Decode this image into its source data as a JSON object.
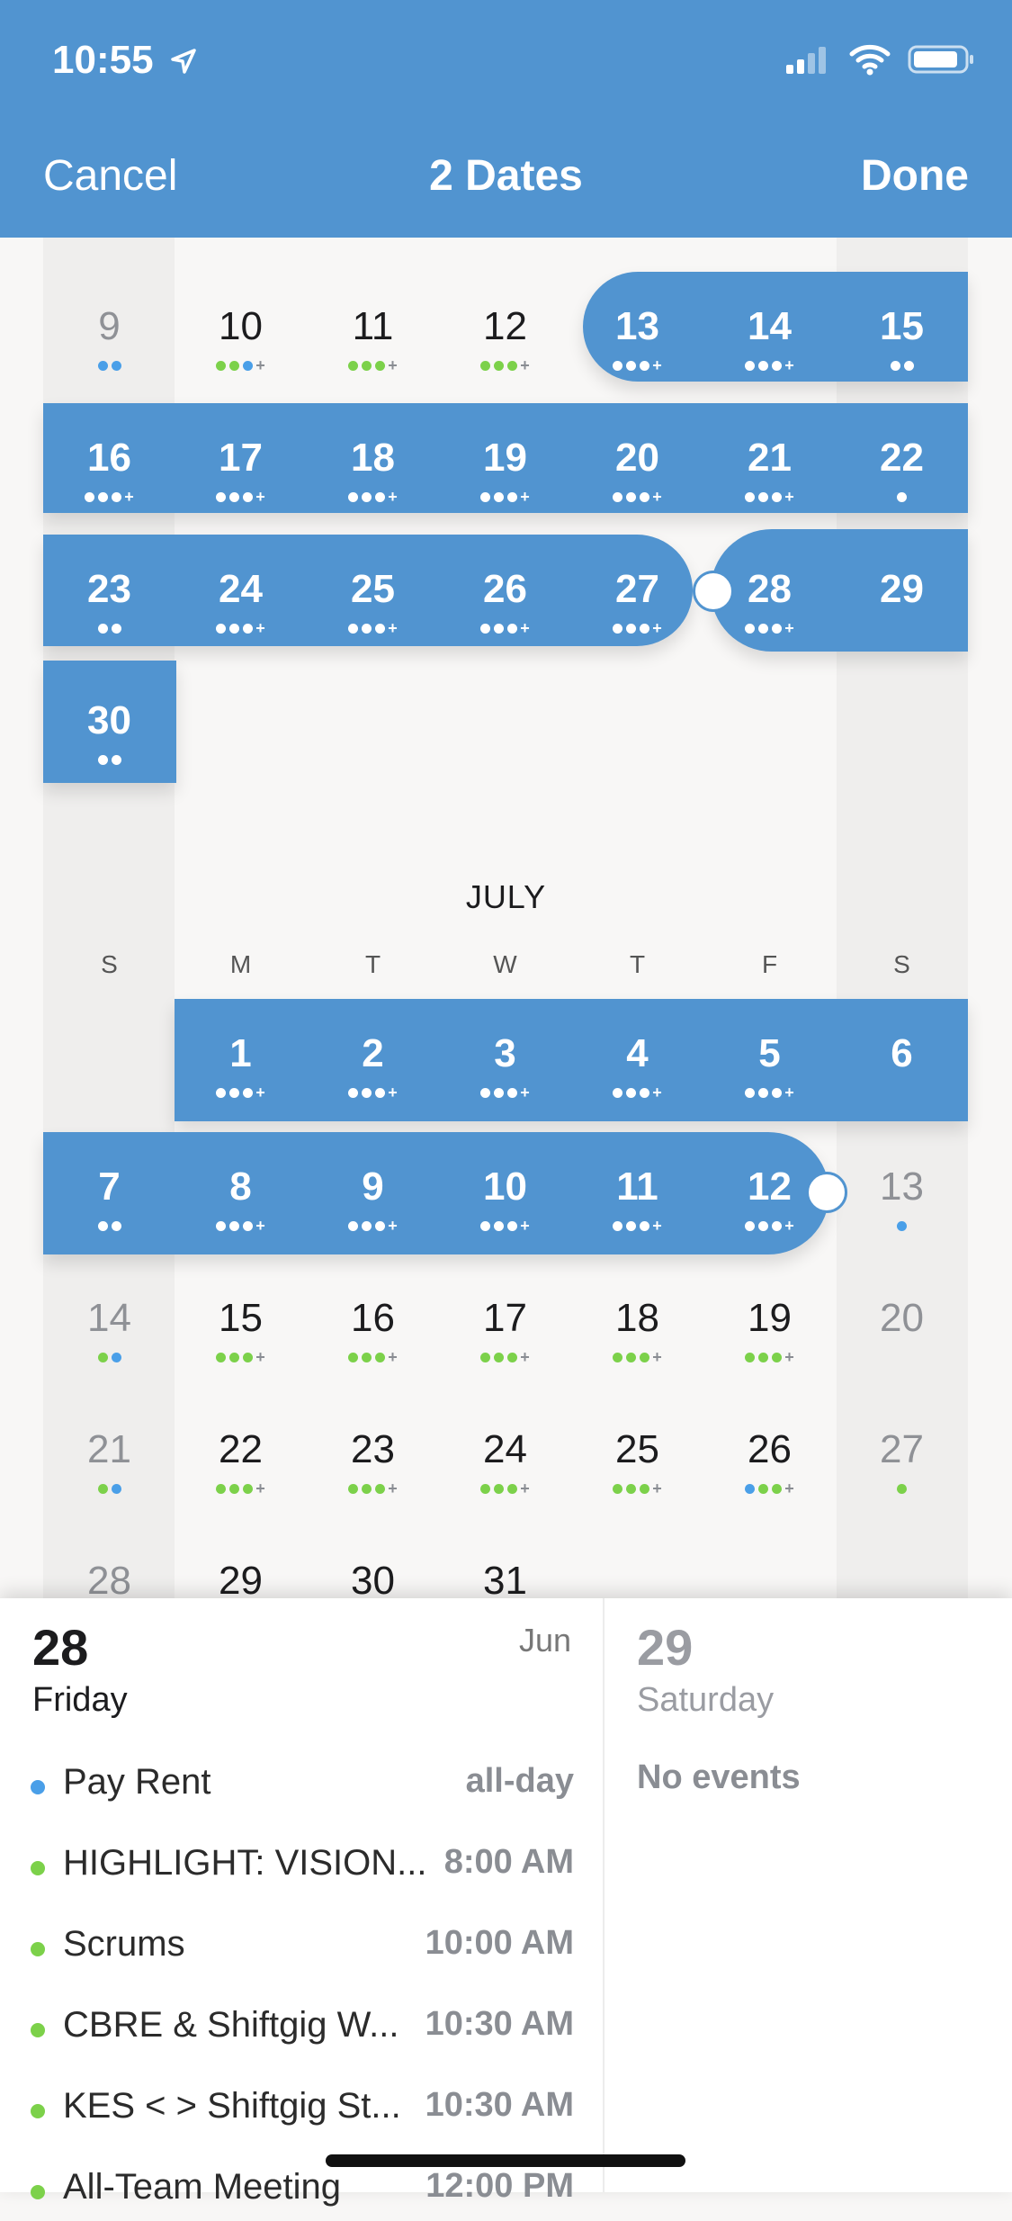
{
  "status": {
    "time": "10:55"
  },
  "nav": {
    "cancel": "Cancel",
    "title": "2 Dates",
    "done": "Done"
  },
  "colors": {
    "accent": "#5194d0",
    "blue_dot": "#4a9fe8",
    "green_dot": "#7cd14a"
  },
  "june": {
    "rows": [
      [
        {
          "d": "9",
          "dots": "bb"
        },
        {
          "d": "10",
          "dots": "ggb+"
        },
        {
          "d": "11",
          "dots": "ggg+"
        },
        {
          "d": "12",
          "dots": "ggg+"
        },
        {
          "d": "13",
          "dots": "www+"
        },
        {
          "d": "14",
          "dots": "www+"
        },
        {
          "d": "15",
          "dots": "ww"
        }
      ],
      [
        {
          "d": "16",
          "dots": "www+"
        },
        {
          "d": "17",
          "dots": "www+"
        },
        {
          "d": "18",
          "dots": "www+"
        },
        {
          "d": "19",
          "dots": "www+"
        },
        {
          "d": "20",
          "dots": "www+"
        },
        {
          "d": "21",
          "dots": "www+"
        },
        {
          "d": "22",
          "dots": "w"
        }
      ],
      [
        {
          "d": "23",
          "dots": "ww"
        },
        {
          "d": "24",
          "dots": "www+"
        },
        {
          "d": "25",
          "dots": "www+"
        },
        {
          "d": "26",
          "dots": "www+"
        },
        {
          "d": "27",
          "dots": "www+"
        },
        {
          "d": "28",
          "dots": "www+"
        },
        {
          "d": "29",
          "dots": ""
        }
      ],
      [
        {
          "d": "30",
          "dots": "ww"
        }
      ]
    ]
  },
  "july": {
    "month_label": "JULY",
    "weekdays": [
      "S",
      "M",
      "T",
      "W",
      "T",
      "F",
      "S"
    ],
    "rows": [
      [
        {
          "d": "",
          "dots": ""
        },
        {
          "d": "1",
          "dots": "www+"
        },
        {
          "d": "2",
          "dots": "www+"
        },
        {
          "d": "3",
          "dots": "www+"
        },
        {
          "d": "4",
          "dots": "www+"
        },
        {
          "d": "5",
          "dots": "www+"
        },
        {
          "d": "6",
          "dots": ""
        }
      ],
      [
        {
          "d": "7",
          "dots": "ww"
        },
        {
          "d": "8",
          "dots": "www+"
        },
        {
          "d": "9",
          "dots": "www+"
        },
        {
          "d": "10",
          "dots": "www+"
        },
        {
          "d": "11",
          "dots": "www+"
        },
        {
          "d": "12",
          "dots": "www+"
        },
        {
          "d": "13",
          "dots": "b"
        }
      ],
      [
        {
          "d": "14",
          "dots": "gb"
        },
        {
          "d": "15",
          "dots": "ggg+"
        },
        {
          "d": "16",
          "dots": "ggg+"
        },
        {
          "d": "17",
          "dots": "ggg+"
        },
        {
          "d": "18",
          "dots": "ggg+"
        },
        {
          "d": "19",
          "dots": "ggg+"
        },
        {
          "d": "20",
          "dots": ""
        }
      ],
      [
        {
          "d": "21",
          "dots": "gb"
        },
        {
          "d": "22",
          "dots": "ggg+"
        },
        {
          "d": "23",
          "dots": "ggg+"
        },
        {
          "d": "24",
          "dots": "ggg+"
        },
        {
          "d": "25",
          "dots": "ggg+"
        },
        {
          "d": "26",
          "dots": "bgg+"
        },
        {
          "d": "27",
          "dots": "g"
        }
      ],
      [
        {
          "d": "28",
          "dots": ""
        },
        {
          "d": "29",
          "dots": ""
        },
        {
          "d": "30",
          "dots": ""
        },
        {
          "d": "31",
          "dots": ""
        }
      ]
    ]
  },
  "selected_day": {
    "day_num": "28",
    "day_name": "Friday",
    "month": "Jun",
    "events": [
      {
        "name": "Pay Rent",
        "time": "all-day",
        "color": "#4a9fe8"
      },
      {
        "name": "HIGHLIGHT: VISION...",
        "time": "8:00 AM",
        "color": "#7cd14a"
      },
      {
        "name": "Scrums",
        "time": "10:00 AM",
        "color": "#7cd14a"
      },
      {
        "name": "CBRE & Shiftgig W...",
        "time": "10:30 AM",
        "color": "#7cd14a"
      },
      {
        "name": "KES < > Shiftgig St...",
        "time": "10:30 AM",
        "color": "#7cd14a"
      },
      {
        "name": "All-Team Meeting",
        "time": "12:00 PM",
        "color": "#7cd14a"
      }
    ]
  },
  "next_day": {
    "day_num": "29",
    "day_name": "Saturday",
    "empty": "No events"
  }
}
